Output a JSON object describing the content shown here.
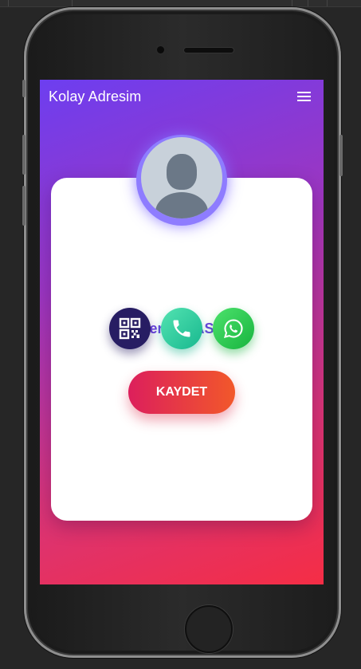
{
  "app": {
    "title": "Kolay Adresim"
  },
  "profile": {
    "name": "eren BAS"
  },
  "actions": {
    "save_label": "KAYDET"
  },
  "icons": {
    "menu": "hamburger-menu-icon",
    "avatar": "default-user-avatar",
    "qr": "qr-code-icon",
    "phone": "phone-icon",
    "whatsapp": "whatsapp-icon"
  },
  "colors": {
    "gradient_start": "#6d3ef0",
    "gradient_end": "#f52d45",
    "name_text": "#6a3fe0",
    "qr_button": "#271d63",
    "call_button": "#2ccf9f",
    "whatsapp_button": "#2cc94f",
    "save_button_start": "#dc1f5c",
    "save_button_end": "#f2582a"
  }
}
